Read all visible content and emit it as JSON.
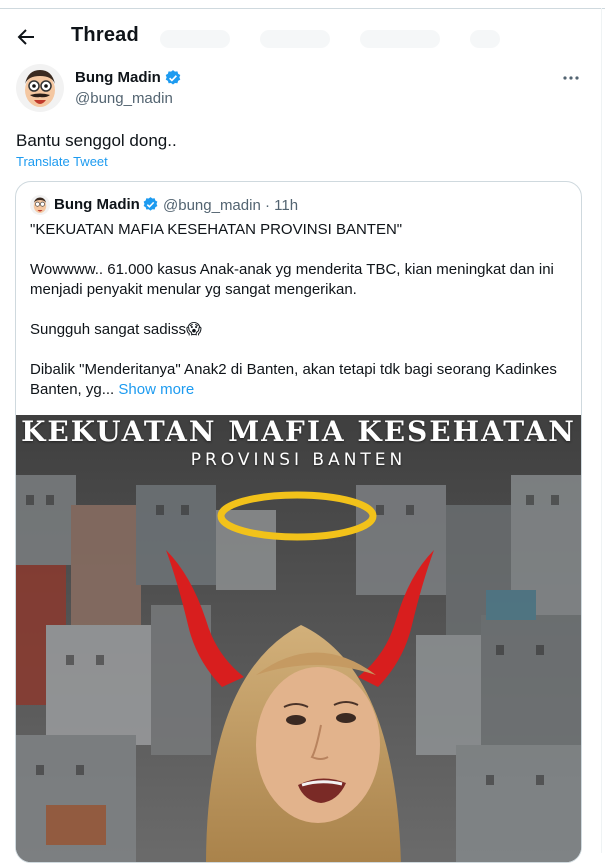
{
  "header": {
    "title": "Thread",
    "back_icon": "arrow-left-icon"
  },
  "tweet": {
    "author_name": "Bung Madin",
    "author_handle": "@bung_madin",
    "text": "Bantu senggol dong..",
    "translate_label": "Translate Tweet",
    "more_icon": "ellipsis-icon"
  },
  "quote": {
    "author_name": "Bung Madin",
    "author_handle": "@bung_madin · 11h",
    "line1": "\"KEKUATAN MAFIA KESEHATAN PROVINSI BANTEN\"",
    "line2": "Wowwww.. 61.000 kasus Anak-anak yg menderita TBC, kian meningkat dan ini menjadi penyakit menular yg sangat mengerikan.",
    "line3": "Sungguh sangat sadiss😱",
    "line4": "Dibalik \"Menderitanya\" Anak2 di Banten, akan tetapi tdk bagi seorang Kadinkes Banten, yg...",
    "show_more": "Show more",
    "media": {
      "title": "KEKUATAN MAFIA KESEHATAN",
      "subtitle": "PROVINSI BANTEN"
    }
  },
  "colors": {
    "link": "#1d9bf0",
    "verified": "#1d9bf0",
    "muted": "#536471",
    "border": "#cfd9de"
  }
}
